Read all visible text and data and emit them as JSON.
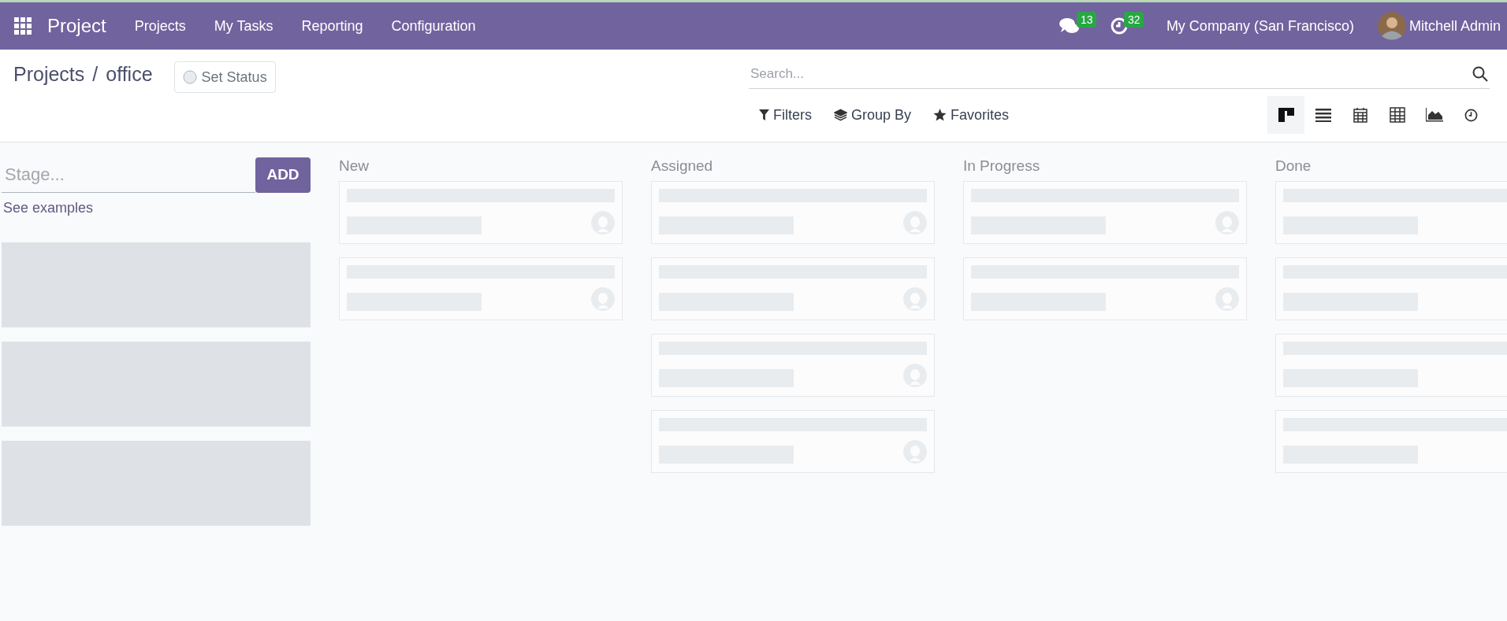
{
  "navbar": {
    "app_name": "Project",
    "menu": [
      "Projects",
      "My Tasks",
      "Reporting",
      "Configuration"
    ],
    "messages_badge": "13",
    "activities_badge": "32",
    "company": "My Company (San Francisco)",
    "user": "Mitchell Admin"
  },
  "breadcrumb": [
    "Projects",
    "office"
  ],
  "breadcrumb_separator": "/",
  "status_button": {
    "label": "Set Status"
  },
  "search": {
    "placeholder": "Search..."
  },
  "search_options": [
    {
      "kind": "filter",
      "label": "Filters"
    },
    {
      "kind": "group",
      "label": "Group By"
    },
    {
      "kind": "favorite",
      "label": "Favorites"
    }
  ],
  "views": [
    {
      "kind": "kanban",
      "selected": true
    },
    {
      "kind": "list",
      "selected": false
    },
    {
      "kind": "calendar",
      "selected": false
    },
    {
      "kind": "pivot",
      "selected": false
    },
    {
      "kind": "graph",
      "selected": false
    },
    {
      "kind": "activity",
      "selected": false
    }
  ],
  "quick_create": {
    "placeholder": "Stage...",
    "button": "ADD",
    "link": "See examples",
    "samples": [
      {
        "kind": "placeholder"
      },
      {
        "kind": "placeholder"
      },
      {
        "kind": "placeholder"
      }
    ]
  },
  "columns": [
    {
      "title": "New",
      "cards": [
        {
          "kind": "placeholder",
          "avatar": true
        },
        {
          "kind": "placeholder",
          "avatar": true
        }
      ]
    },
    {
      "title": "Assigned",
      "cards": [
        {
          "kind": "placeholder",
          "avatar": true
        },
        {
          "kind": "placeholder",
          "avatar": true
        },
        {
          "kind": "placeholder",
          "avatar": true
        },
        {
          "kind": "placeholder",
          "avatar": true
        }
      ]
    },
    {
      "title": "In Progress",
      "cards": [
        {
          "kind": "placeholder",
          "avatar": true
        },
        {
          "kind": "placeholder",
          "avatar": true
        }
      ]
    },
    {
      "title": "Done",
      "cards": [
        {
          "kind": "placeholder"
        },
        {
          "kind": "placeholder"
        },
        {
          "kind": "placeholder"
        },
        {
          "kind": "placeholder"
        }
      ]
    }
  ]
}
